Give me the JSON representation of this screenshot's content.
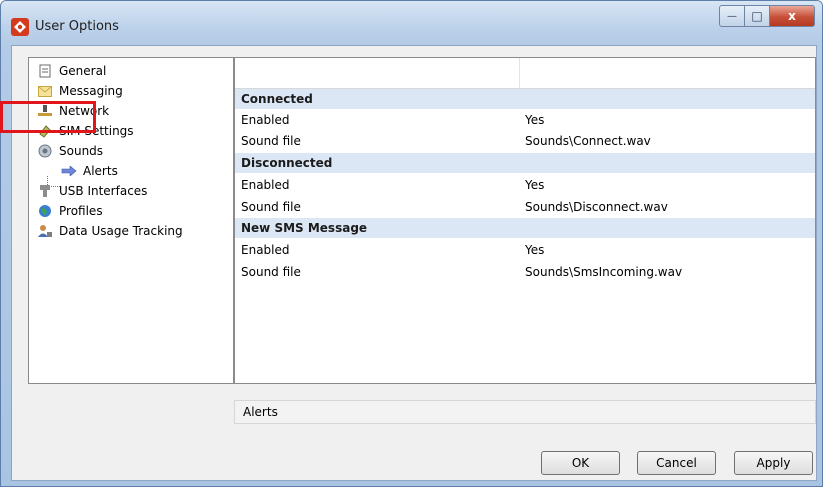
{
  "window": {
    "title": "User Options",
    "controls": {
      "minimize": "—",
      "maximize": "□",
      "close": "x"
    }
  },
  "tree": {
    "items": [
      {
        "label": "General",
        "icon": "general-icon"
      },
      {
        "label": "Messaging",
        "icon": "envelope-icon"
      },
      {
        "label": "Network",
        "icon": "network-icon"
      },
      {
        "label": "SIM Settings",
        "icon": "sim-card-icon"
      },
      {
        "label": "Sounds",
        "icon": "speaker-icon"
      },
      {
        "label": "Alerts",
        "icon": "arrow-right-icon"
      },
      {
        "label": "USB Interfaces",
        "icon": "usb-icon"
      },
      {
        "label": "Profiles",
        "icon": "globe-icon"
      },
      {
        "label": "Data Usage Tracking",
        "icon": "person-icon"
      }
    ]
  },
  "grid": {
    "groups": [
      {
        "title": "Connected",
        "rows": [
          {
            "key": "Enabled",
            "value": "Yes"
          },
          {
            "key": "Sound file",
            "value": "Sounds\\Connect.wav"
          }
        ]
      },
      {
        "title": "Disconnected",
        "rows": [
          {
            "key": "Enabled",
            "value": "Yes"
          },
          {
            "key": "Sound file",
            "value": "Sounds\\Disconnect.wav"
          }
        ]
      },
      {
        "title": "New SMS Message",
        "rows": [
          {
            "key": "Enabled",
            "value": "Yes"
          },
          {
            "key": "Sound file",
            "value": "Sounds\\SmsIncoming.wav"
          }
        ]
      }
    ]
  },
  "status": {
    "text": "Alerts"
  },
  "buttons": {
    "ok": "OK",
    "cancel": "Cancel",
    "apply": "Apply"
  },
  "colors": {
    "highlight": "#e0161a",
    "group_bg": "#dce7f5"
  }
}
